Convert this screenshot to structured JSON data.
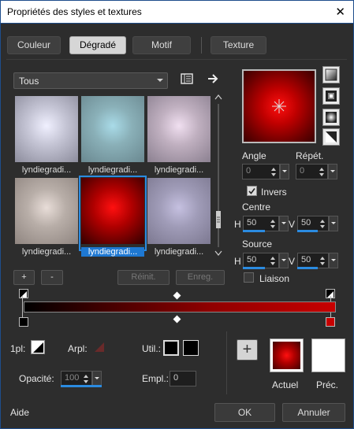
{
  "window": {
    "title": "Propriétés des styles et textures",
    "close": "✕"
  },
  "tabs": [
    {
      "label": "Couleur"
    },
    {
      "label": "Dégradé"
    },
    {
      "label": "Motif"
    },
    {
      "label": "Texture"
    }
  ],
  "gallery": {
    "select_value": "Tous",
    "items": [
      {
        "label": "lyndiegradi...",
        "color1": "#f0f0ff",
        "color2": "#8c8c9c"
      },
      {
        "label": "lyndiegradi...",
        "color1": "#a9dbe8",
        "color2": "#6a8890"
      },
      {
        "label": "lyndiegradi...",
        "color1": "#f0dff0",
        "color2": "#8b8090"
      },
      {
        "label": "lyndiegradi...",
        "color1": "#e8ddd8",
        "color2": "#8f8580"
      },
      {
        "label": "lyndiegradi...",
        "color1": "#ff1010",
        "color2": "#300000"
      },
      {
        "label": "lyndiegradi...",
        "color1": "#c5c0e0",
        "color2": "#7c7890"
      }
    ],
    "buttons": {
      "add": "+",
      "remove": "-",
      "reset": "Réinit.",
      "save": "Enreg."
    }
  },
  "angle": {
    "label": "Angle",
    "value": "0"
  },
  "repeat": {
    "label": "Répét.",
    "value": "0"
  },
  "invert": {
    "label": "Invers",
    "checked": true
  },
  "center": {
    "label": "Centre",
    "h_label": "H",
    "h_value": "50",
    "v_label": "V",
    "v_value": "50"
  },
  "source": {
    "label": "Source",
    "h_label": "H",
    "h_value": "50",
    "v_label": "V",
    "v_value": "50"
  },
  "link": {
    "label": "Liaison",
    "checked": false
  },
  "bottom": {
    "pl_label": "1pl:",
    "arpl_label": "Arpl:",
    "util_label": "Util.:",
    "opacity_label": "Opacité:",
    "opacity_value": "100",
    "empl_label": "Empl.:",
    "empl_value": "0",
    "add": "+",
    "current_label": "Actuel",
    "previous_label": "Préc."
  },
  "footer": {
    "help": "Aide",
    "ok": "OK",
    "cancel": "Annuler"
  },
  "colors": {
    "accent": "#2b8be0",
    "gradient_end": "#c70000"
  }
}
